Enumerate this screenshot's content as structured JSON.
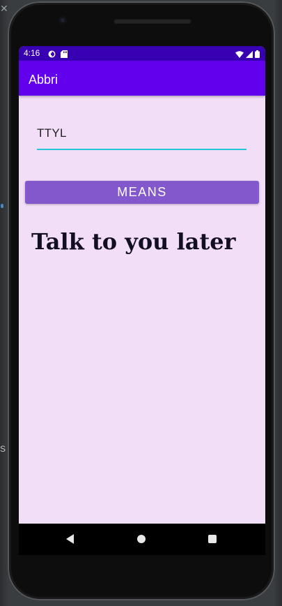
{
  "status_bar": {
    "time": "4:16",
    "left_icons": [
      "data-saver-icon",
      "sd-card-icon"
    ],
    "right_icons": [
      "wifi-icon",
      "cell-signal-icon",
      "battery-icon"
    ]
  },
  "app_bar": {
    "title": "Abbri"
  },
  "input": {
    "value": "TTYL"
  },
  "button": {
    "label": "MEANS"
  },
  "result": {
    "text": "Talk to you later"
  },
  "nav_bar": {
    "icons": [
      "back-icon",
      "home-icon",
      "recents-icon"
    ]
  },
  "colors": {
    "status_bar": "#3700b3",
    "app_bar": "#6200ee",
    "screen_background": "#f3def8",
    "button": "#8358cd",
    "input_underline": "#26c6da"
  }
}
